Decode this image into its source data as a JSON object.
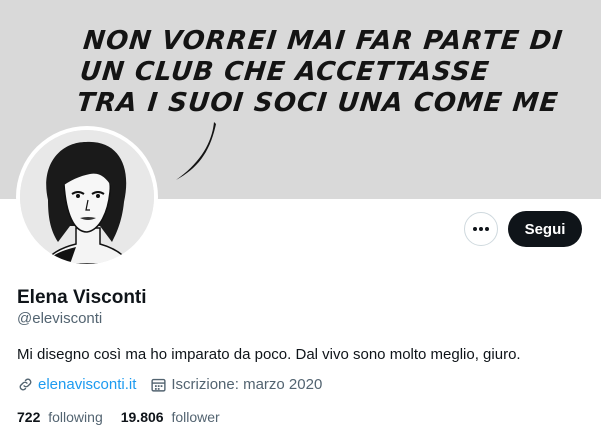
{
  "banner": {
    "lines": [
      "NON VORREI MAI FAR PARTE DI",
      "UN CLUB CHE ACCETTASSE",
      "TRA I SUOI SOCI UNA COME ME"
    ]
  },
  "profile": {
    "name": "Elena Visconti",
    "handle": "@elevisconti",
    "bio": "Mi disegno così ma ho imparato da poco. Dal vivo sono molto meglio, giuro.",
    "website": "elenavisconti.it",
    "joined": "Iscrizione: marzo 2020",
    "following_count": "722",
    "following_label": "following",
    "followers_count": "19.806",
    "followers_label": "follower"
  },
  "actions": {
    "more_icon": "more-dots-icon",
    "follow_label": "Segui"
  },
  "icons": {
    "link": "link-icon",
    "calendar": "calendar-icon"
  },
  "colors": {
    "accent": "#1d9bf0",
    "text": "#0f1419",
    "muted": "#536471",
    "banner_bg": "#d9d9d9"
  }
}
